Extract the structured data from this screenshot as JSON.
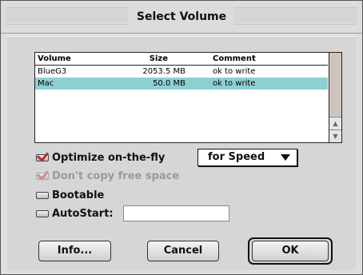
{
  "window": {
    "title": "Select Volume"
  },
  "volume_list": {
    "columns": [
      "Volume",
      "Size",
      "Comment"
    ],
    "rows": [
      {
        "volume": "BlueG3",
        "size": "2053.5 MB",
        "comment": "ok to write",
        "selected": false
      },
      {
        "volume": "Mac",
        "size": "50.0 MB",
        "comment": "ok to write",
        "selected": true
      }
    ],
    "selection_color": "#8ed0d2"
  },
  "options": {
    "optimize": {
      "label": "Optimize on-the-fly",
      "checked": true,
      "enabled": true
    },
    "optimize_mode": {
      "value": "for Speed"
    },
    "dont_copy_free": {
      "label": "Don't copy free space",
      "checked": true,
      "enabled": false
    },
    "bootable": {
      "label": "Bootable",
      "checked": false,
      "enabled": true
    },
    "autostart": {
      "label": "AutoStart:",
      "checked": false,
      "enabled": true,
      "field_value": ""
    }
  },
  "buttons": {
    "info": "Info...",
    "cancel": "Cancel",
    "ok": "OK"
  },
  "icons": {
    "checkbox_check": "check-mark-icon",
    "popup_arrow": "triangle-down-icon",
    "scroll_up": "scroll-up-arrow-icon",
    "scroll_down": "scroll-down-arrow-icon"
  }
}
